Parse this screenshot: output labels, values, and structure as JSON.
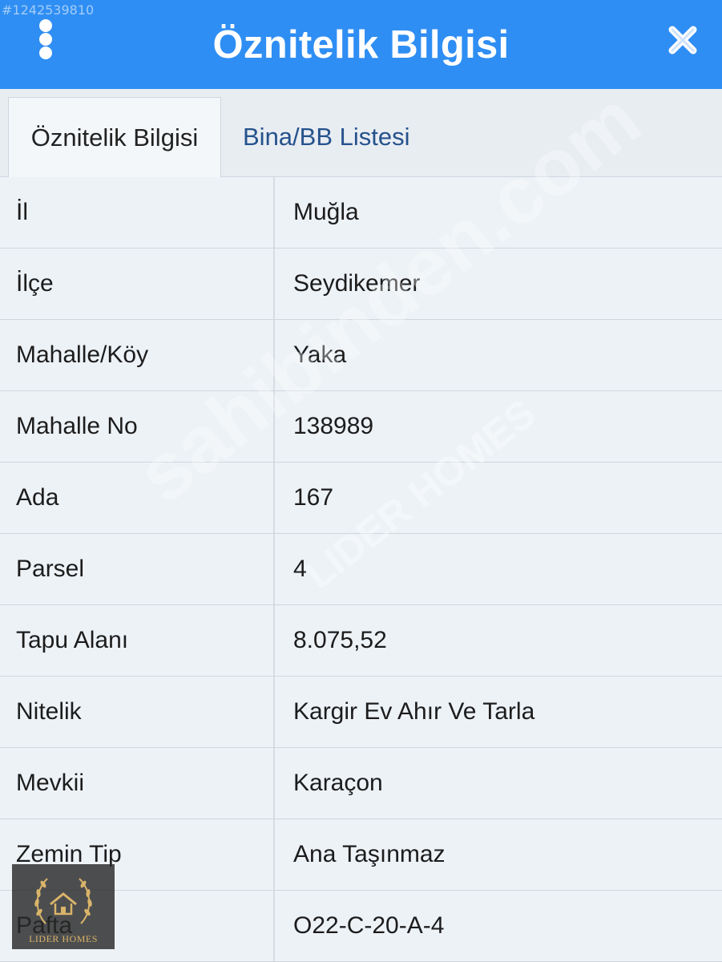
{
  "watermark_id": "#1242539810",
  "header": {
    "title": "Öznitelik Bilgisi"
  },
  "tabs": [
    {
      "label": "Öznitelik Bilgisi",
      "active": true
    },
    {
      "label": "Bina/BB Listesi",
      "active": false
    }
  ],
  "rows": [
    {
      "label": "İl",
      "value": "Muğla"
    },
    {
      "label": "İlçe",
      "value": "Seydikemer"
    },
    {
      "label": "Mahalle/Köy",
      "value": "Yaka"
    },
    {
      "label": "Mahalle No",
      "value": "138989"
    },
    {
      "label": "Ada",
      "value": "167"
    },
    {
      "label": "Parsel",
      "value": "4"
    },
    {
      "label": "Tapu Alanı",
      "value": "8.075,52"
    },
    {
      "label": "Nitelik",
      "value": "Kargir Ev Ahır Ve Tarla"
    },
    {
      "label": "Mevkii",
      "value": "Karaçon"
    },
    {
      "label": "Zemin Tip",
      "value": "Ana Taşınmaz"
    },
    {
      "label": "Pafta",
      "value": "O22-C-20-A-4"
    }
  ],
  "watermarks": {
    "site": "sahibinden.com",
    "brand": "LIDER HOMES"
  },
  "logo": {
    "text": "LIDER HOMES"
  },
  "colors": {
    "header_bg": "#2f8ef3",
    "tab_inactive_text": "#25528c",
    "row_bg": "#edf2f7",
    "logo_gold": "#d9b46a"
  }
}
